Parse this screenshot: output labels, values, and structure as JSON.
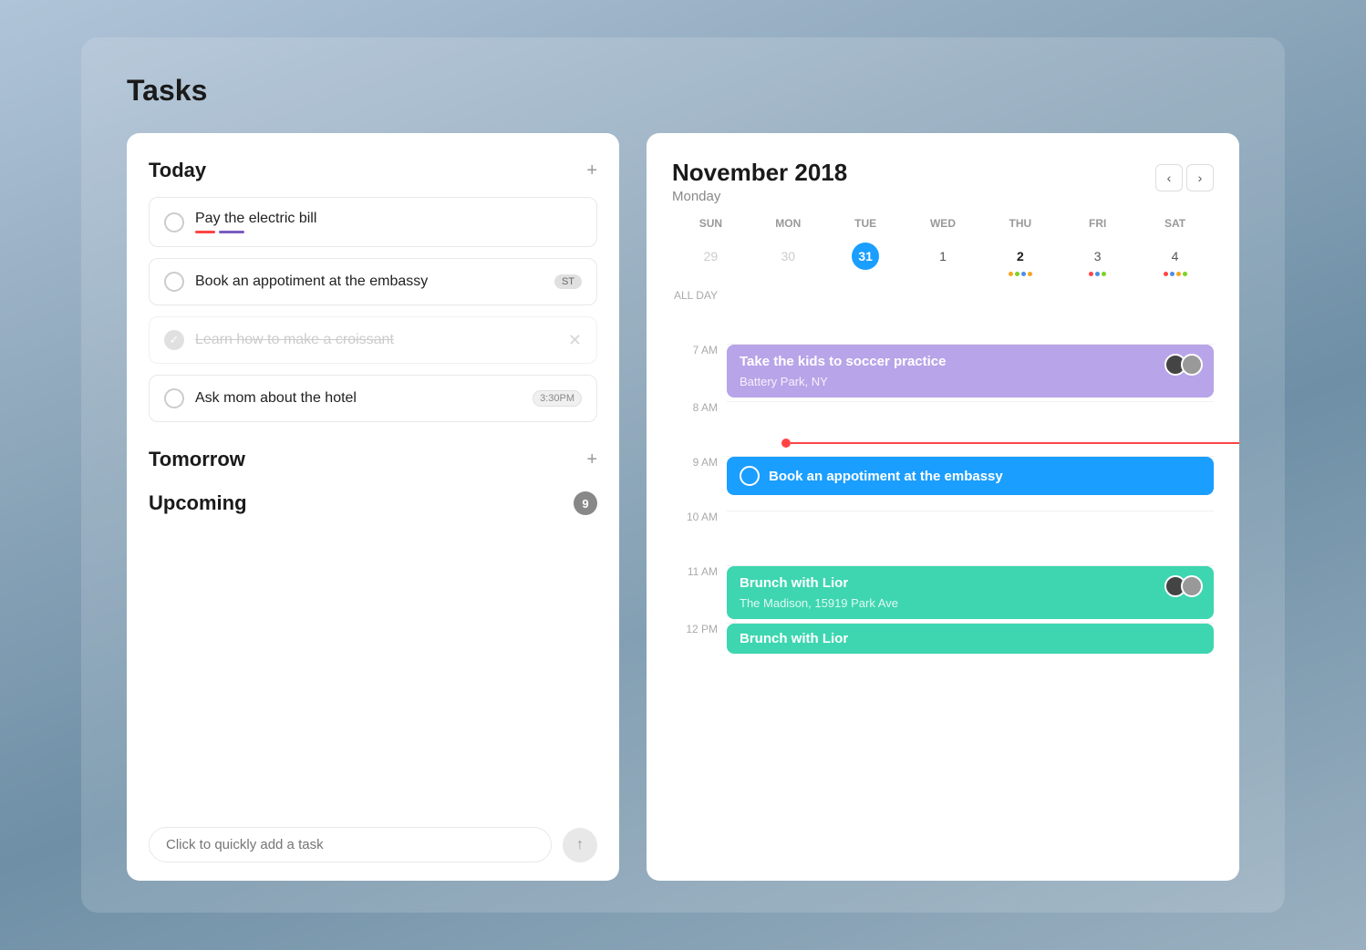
{
  "app": {
    "title": "Tasks"
  },
  "left": {
    "today_label": "Today",
    "tomorrow_label": "Tomorrow",
    "upcoming_label": "Upcoming",
    "upcoming_count": "9",
    "quick_add_placeholder": "Click to quickly add a task",
    "tasks": [
      {
        "id": "task-1",
        "text": "Pay the electric bill",
        "completed": false,
        "has_underlines": true,
        "badge": null,
        "time_badge": null
      },
      {
        "id": "task-2",
        "text": "Book an appotiment at the embassy",
        "completed": false,
        "has_underlines": false,
        "badge": "ST",
        "time_badge": null
      },
      {
        "id": "task-3",
        "text": "Learn how to make a croissant",
        "completed": true,
        "has_underlines": false,
        "badge": null,
        "time_badge": null
      },
      {
        "id": "task-4",
        "text": "Ask mom about the hotel",
        "completed": false,
        "has_underlines": false,
        "badge": null,
        "time_badge": "3:30PM"
      }
    ]
  },
  "right": {
    "month": "November 2018",
    "day_label": "Monday",
    "weekdays": [
      "SUN",
      "MON",
      "TUE",
      "WED",
      "THU",
      "FRI",
      "SAT"
    ],
    "weeks": [
      [
        {
          "num": "29",
          "muted": true,
          "today": false,
          "bold": false,
          "dots": []
        },
        {
          "num": "30",
          "muted": true,
          "today": false,
          "bold": false,
          "dots": []
        },
        {
          "num": "31",
          "muted": false,
          "today": true,
          "bold": false,
          "dots": []
        },
        {
          "num": "1",
          "muted": false,
          "today": false,
          "bold": false,
          "dots": []
        },
        {
          "num": "2",
          "muted": false,
          "today": false,
          "bold": true,
          "dots": [
            "#f6a623",
            "#7ed321",
            "#4a90e2",
            "#f5a623"
          ]
        },
        {
          "num": "3",
          "muted": false,
          "today": false,
          "bold": false,
          "dots": [
            "#f44",
            "#4a90e2",
            "#7ed321"
          ]
        },
        {
          "num": "4",
          "muted": false,
          "today": false,
          "bold": false,
          "dots": [
            "#f44",
            "#4a90e2",
            "#f6a623",
            "#7ed321"
          ]
        }
      ]
    ],
    "timeline": [
      {
        "time": "ALL DAY",
        "events": []
      },
      {
        "time": "7 AM",
        "events": [
          {
            "type": "purple",
            "title": "Take the kids to soccer practice",
            "location": "Battery Park, NY",
            "avatars": true
          }
        ]
      },
      {
        "time": "8 AM",
        "events": []
      },
      {
        "time": "9 AM",
        "events": [
          {
            "type": "blue",
            "title": "Book an appotiment at the embassy",
            "location": null,
            "avatars": false,
            "has_circle": true
          }
        ]
      },
      {
        "time": "10 AM",
        "events": []
      },
      {
        "time": "11 AM",
        "events": [
          {
            "type": "teal",
            "title": "Brunch with Lior",
            "location": "The Madison, 15919 Park Ave",
            "avatars": true
          }
        ]
      },
      {
        "time": "12 PM",
        "events": [
          {
            "type": "teal",
            "title": "Brunch with Lior",
            "location": null,
            "avatars": false
          }
        ]
      }
    ]
  }
}
